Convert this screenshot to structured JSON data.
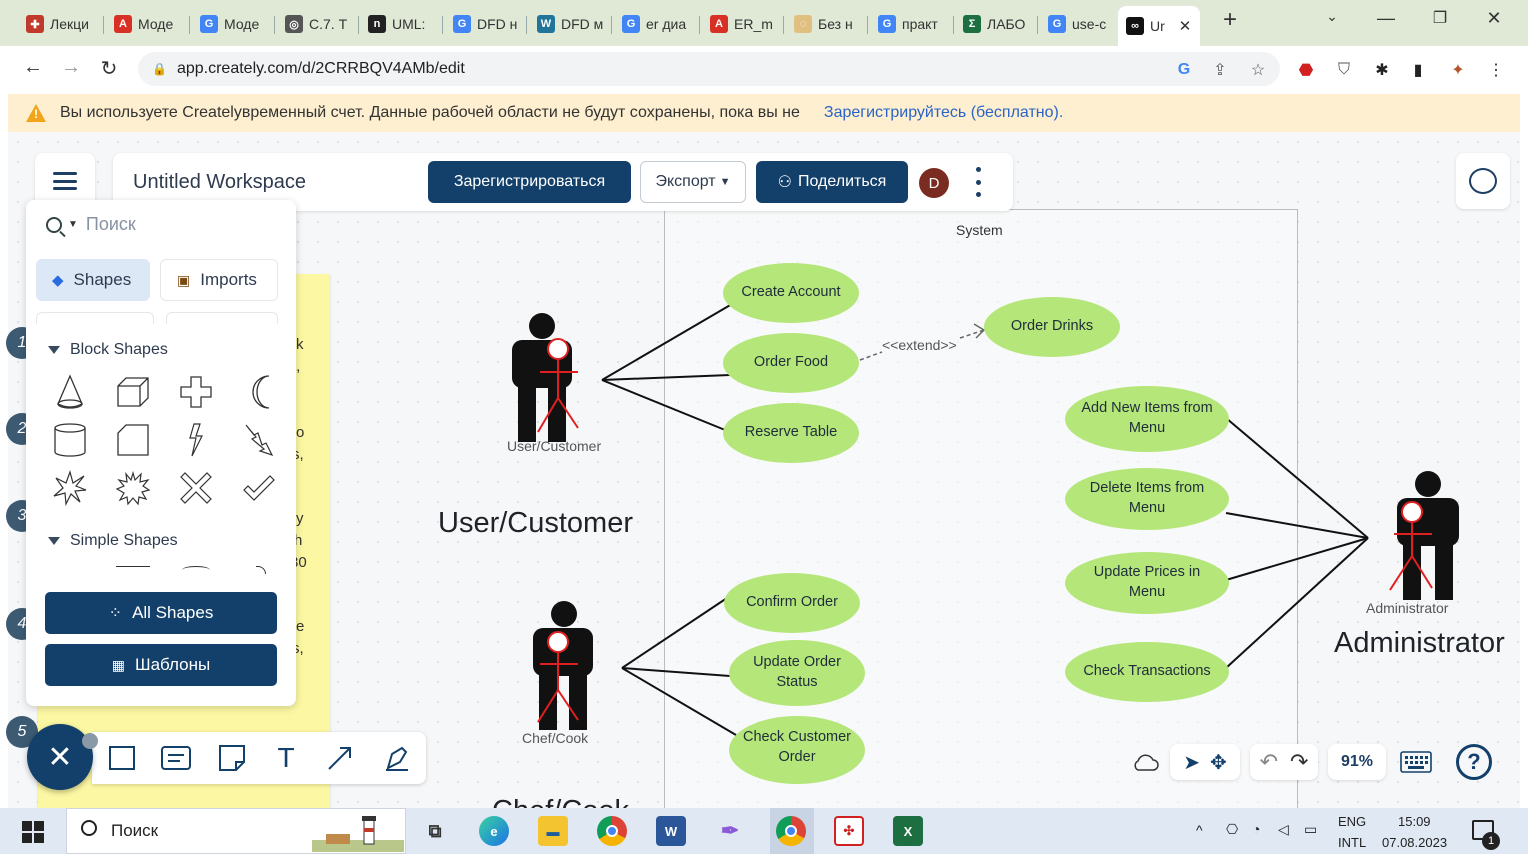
{
  "browser": {
    "tabs": [
      {
        "label": "Лекци",
        "color": "#c0392b",
        "glyph": "✚"
      },
      {
        "label": "Моде",
        "color": "#d93025",
        "glyph": "A"
      },
      {
        "label": "Моде",
        "color": "#4285f4",
        "glyph": "G"
      },
      {
        "label": "C.7. Т",
        "color": "#555",
        "glyph": "◎"
      },
      {
        "label": "UML:",
        "color": "#222",
        "glyph": "n"
      },
      {
        "label": "DFD н",
        "color": "#4285f4",
        "glyph": "G"
      },
      {
        "label": "DFD м",
        "color": "#21759b",
        "glyph": "W"
      },
      {
        "label": "er диа",
        "color": "#4285f4",
        "glyph": "G"
      },
      {
        "label": "ER_m",
        "color": "#d93025",
        "glyph": "A"
      },
      {
        "label": "Без н",
        "color": "#e0c080",
        "glyph": "◌"
      },
      {
        "label": "практ",
        "color": "#4285f4",
        "glyph": "G"
      },
      {
        "label": "ЛАБО",
        "color": "#1d6f42",
        "glyph": "Σ"
      },
      {
        "label": "use-c",
        "color": "#4285f4",
        "glyph": "G"
      },
      {
        "label": "Ur",
        "color": "#111",
        "glyph": "∞"
      }
    ],
    "new_tab": "+",
    "url": "app.creately.com/d/2CRRBQV4AMb/edit"
  },
  "banner": {
    "text": "Вы используете Createlyвременный счет. Данные рабочей области не будут сохранены, пока вы не",
    "link": "Зарегистрируйтесь (бесплатно)."
  },
  "app": {
    "workspace_title": "Untitled Workspace",
    "register_button": "Зарегистрироваться",
    "export_button": "Экспорт",
    "share_button": "Поделиться",
    "avatar_initial": "D",
    "zoom": "91%"
  },
  "panel": {
    "search_placeholder": "Поиск",
    "tab_shapes": "Shapes",
    "tab_imports": "Imports",
    "section_block": "Block Shapes",
    "section_simple": "Simple Shapes",
    "all_shapes_button": "All Shapes",
    "templates_button": "Шаблоны"
  },
  "sticky": {
    "step_numbers": [
      "1",
      "2",
      "3",
      "4",
      "5"
    ],
    "fragments": [
      "k",
      "t,",
      "o",
      "s,",
      "y",
      "h",
      "30",
      "e",
      "s,"
    ]
  },
  "diagram": {
    "system_label": "System",
    "extend_label": "<<extend>>",
    "actors": {
      "customer_small": "User/Customer",
      "customer_big": "User/Customer",
      "chef_small": "Chef/Cook",
      "chef_big": "Chef/Cook",
      "admin_small": "Administrator",
      "admin_big": "Administrator"
    },
    "use_cases": {
      "create_account": "Create Account",
      "order_food": "Order Food",
      "reserve_table": "Reserve Table",
      "order_drinks": "Order Drinks",
      "confirm_order": "Confirm Order",
      "update_status": "Update Order Status",
      "check_customer": "Check Customer Order",
      "add_items": "Add New Items from Menu",
      "delete_items": "Delete Items from Menu",
      "update_prices": "Update Prices in Menu",
      "check_transactions": "Check Transactions"
    }
  },
  "taskbar": {
    "search": "Поиск",
    "lang_top": "ENG",
    "lang_bottom": "INTL",
    "time": "15:09",
    "date": "07.08.2023",
    "notif_count": "1"
  },
  "colors": {
    "accent": "#13406b",
    "usecase": "#b5e67a",
    "banner": "#fdefcf",
    "sticky": "#fbf7a2"
  }
}
